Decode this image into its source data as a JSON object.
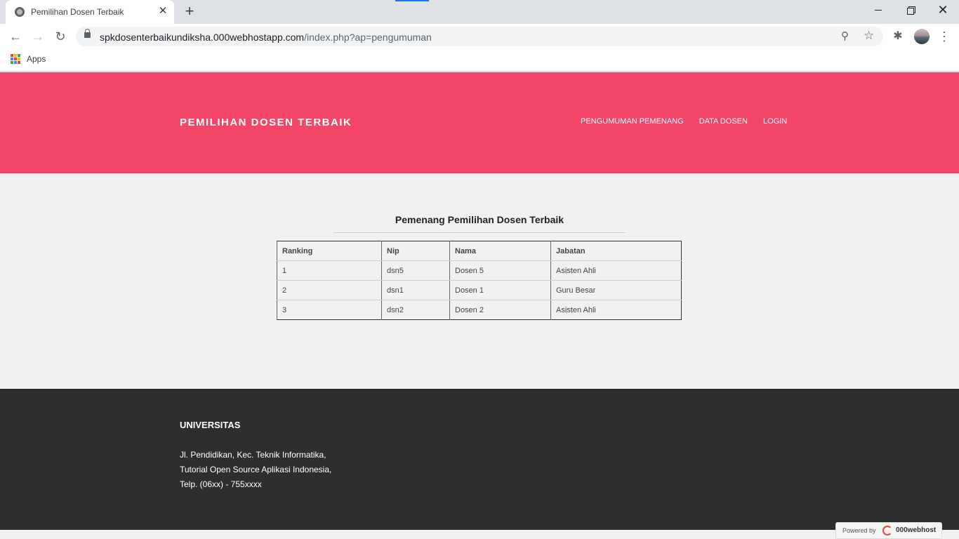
{
  "browser": {
    "tab_title": "Pemilihan Dosen Terbaik",
    "tab_close": "✕",
    "new_tab": "+",
    "url_host": "spkdosenterbaikundiksha.000webhostapp.com",
    "url_path": "/index.php?ap=pengumuman",
    "window_close": "✕",
    "nav_back": "←",
    "nav_forward": "→",
    "nav_reload": "↻",
    "zoom_glyph": "⚲",
    "star_glyph": "☆",
    "extensions_glyph": "✱",
    "menu_glyph": "⋮",
    "bookmarks": {
      "apps_label": "Apps"
    },
    "apps_colors": [
      "#ea4335",
      "#fbbc05",
      "#34a853",
      "#4285f4",
      "#ea4335",
      "#fbbc05",
      "#34a853",
      "#4285f4",
      "#ea4335"
    ]
  },
  "header": {
    "brand": "PEMILIHAN DOSEN TERBAIK",
    "nav": [
      "PENGUMUMAN PEMENANG",
      "DATA DOSEN",
      "LOGIN"
    ],
    "color": "#f24567"
  },
  "main": {
    "title": "Pemenang Pemilihan Dosen Terbaik",
    "table": {
      "columns": [
        "Ranking",
        "Nip",
        "Nama",
        "Jabatan"
      ],
      "rows": [
        [
          "1",
          "dsn5",
          "Dosen 5",
          "Asisten Ahli"
        ],
        [
          "2",
          "dsn1",
          "Dosen 1",
          "Guru Besar"
        ],
        [
          "3",
          "dsn2",
          "Dosen 2",
          "Asisten Ahli"
        ]
      ]
    }
  },
  "footer": {
    "title": "UNIVERSITAS",
    "address_lines": [
      "Jl. Pendidikan, Kec. Teknik Informatika,",
      "Tutorial Open Source Aplikasi Indonesia,",
      "Telp. (06xx) - 755xxxx"
    ],
    "color": "#2e2e2e"
  },
  "badge": {
    "powered_by": "Powered by",
    "host": "000webhost"
  }
}
